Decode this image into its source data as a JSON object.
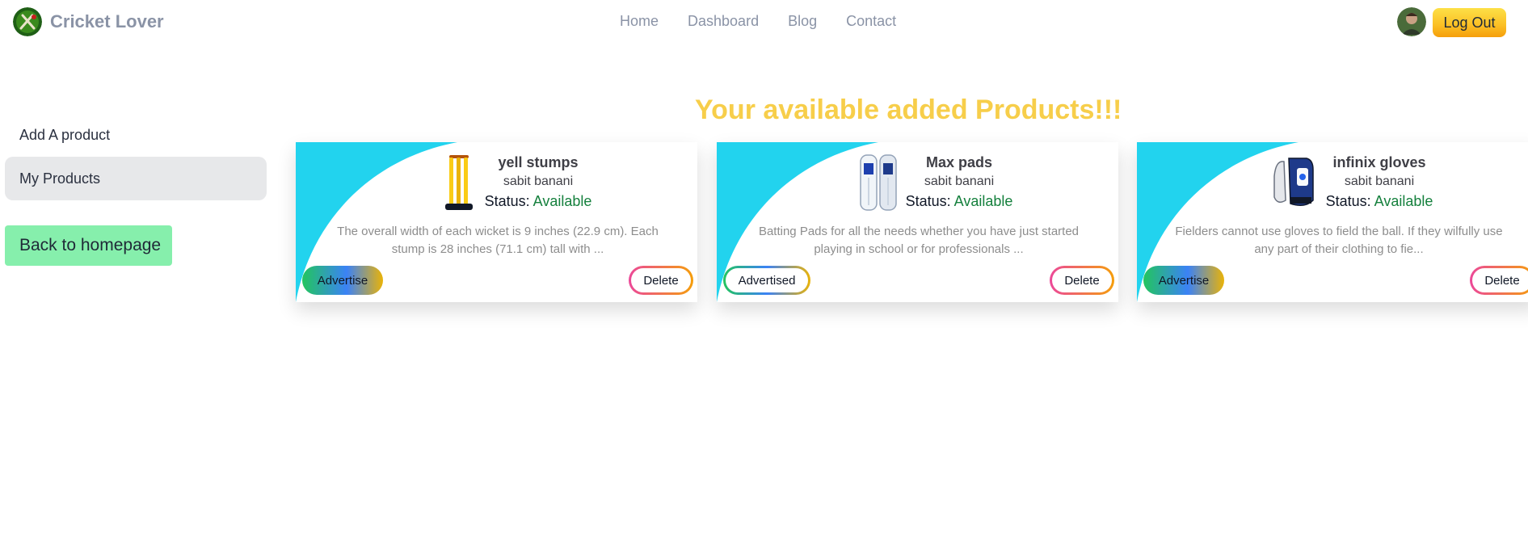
{
  "navbar": {
    "brand_name": "Cricket Lover",
    "links": [
      "Home",
      "Dashboard",
      "Blog",
      "Contact"
    ],
    "logout_label": "Log Out"
  },
  "sidebar": {
    "items": [
      {
        "label": "Add A product"
      },
      {
        "label": "My Products",
        "active": true
      }
    ],
    "back_label": "Back to homepage"
  },
  "main": {
    "heading": "Your available added Products!!!",
    "products": [
      {
        "title": "yell stumps",
        "seller": "sabit banani",
        "status_label": "Status:",
        "status": "Available",
        "description": "The overall width of each wicket is 9 inches (22.9 cm). Each stump is 28 inches (71.1 cm) tall with ...",
        "advertise_label": "Advertise",
        "delete_label": "Delete"
      },
      {
        "title": "Max pads",
        "seller": "sabit banani",
        "status_label": "Status:",
        "status": "Available",
        "description": "Batting Pads for all the needs whether you have just started playing in school or for professionals ...",
        "advertise_label": "Advertised",
        "delete_label": "Delete"
      },
      {
        "title": "infinix gloves",
        "seller": "sabit banani",
        "status_label": "Status:",
        "status": "Available",
        "description": "Fielders cannot use gloves to field the ball. If they wilfully use any part of their clothing to fie...",
        "advertise_label": "Advertise",
        "delete_label": "Delete"
      }
    ]
  },
  "colors": {
    "heading": "#f7ce4a",
    "card_accent": "#22d3ee",
    "status_available": "#15803d",
    "back_button": "#86efac"
  }
}
